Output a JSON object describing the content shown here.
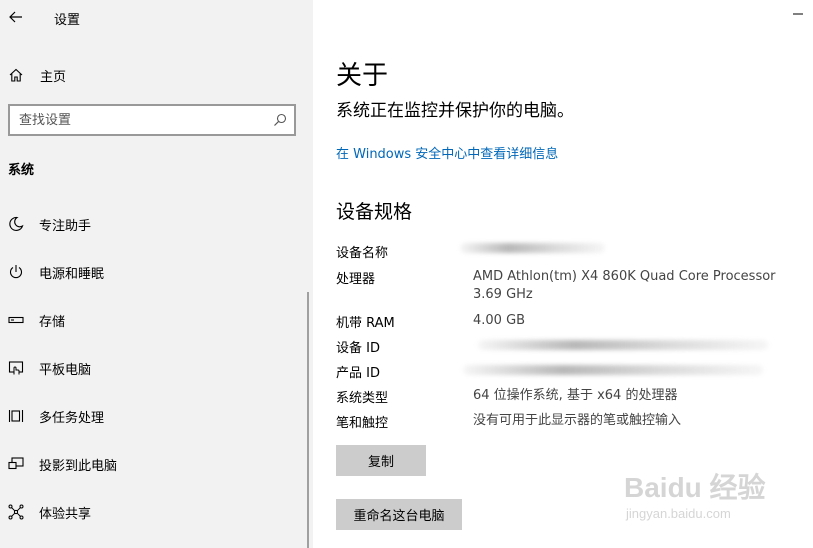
{
  "app": {
    "title": "设置"
  },
  "sidebar": {
    "home_label": "主页",
    "search": {
      "placeholder": "查找设置",
      "value": ""
    },
    "section_title": "系统",
    "items": [
      {
        "label": "专注助手",
        "icon": "moon-icon"
      },
      {
        "label": "电源和睡眠",
        "icon": "power-icon"
      },
      {
        "label": "存储",
        "icon": "storage-icon"
      },
      {
        "label": "平板电脑",
        "icon": "tablet-mode-icon"
      },
      {
        "label": "多任务处理",
        "icon": "multitasking-icon"
      },
      {
        "label": "投影到此电脑",
        "icon": "project-icon"
      },
      {
        "label": "体验共享",
        "icon": "shared-experiences-icon"
      }
    ]
  },
  "main": {
    "title": "关于",
    "status": "系统正在监控并保护你的电脑。",
    "security_link": "在 Windows 安全中心中查看详细信息",
    "specs_heading": "设备规格",
    "specs": [
      {
        "label": "设备名称",
        "value": ""
      },
      {
        "label": "处理器",
        "value": "AMD Athlon(tm) X4 860K Quad Core Processor",
        "value2": "3.69 GHz"
      },
      {
        "label": "机带 RAM",
        "value": "4.00 GB"
      },
      {
        "label": "设备 ID",
        "value": ""
      },
      {
        "label": "产品 ID",
        "value": ""
      },
      {
        "label": "系统类型",
        "value": "64 位操作系统, 基于 x64 的处理器"
      },
      {
        "label": "笔和触控",
        "value": "没有可用于此显示器的笔或触控输入"
      }
    ],
    "copy_button": "复制",
    "rename_button": "重命名这台电脑"
  },
  "watermark": {
    "main": "Baidu 经验",
    "sub": "jingyan.baidu.com"
  },
  "colors": {
    "sidebar_bg": "#f2f2f2",
    "link": "#0067b8",
    "button_bg": "#cccccc"
  }
}
